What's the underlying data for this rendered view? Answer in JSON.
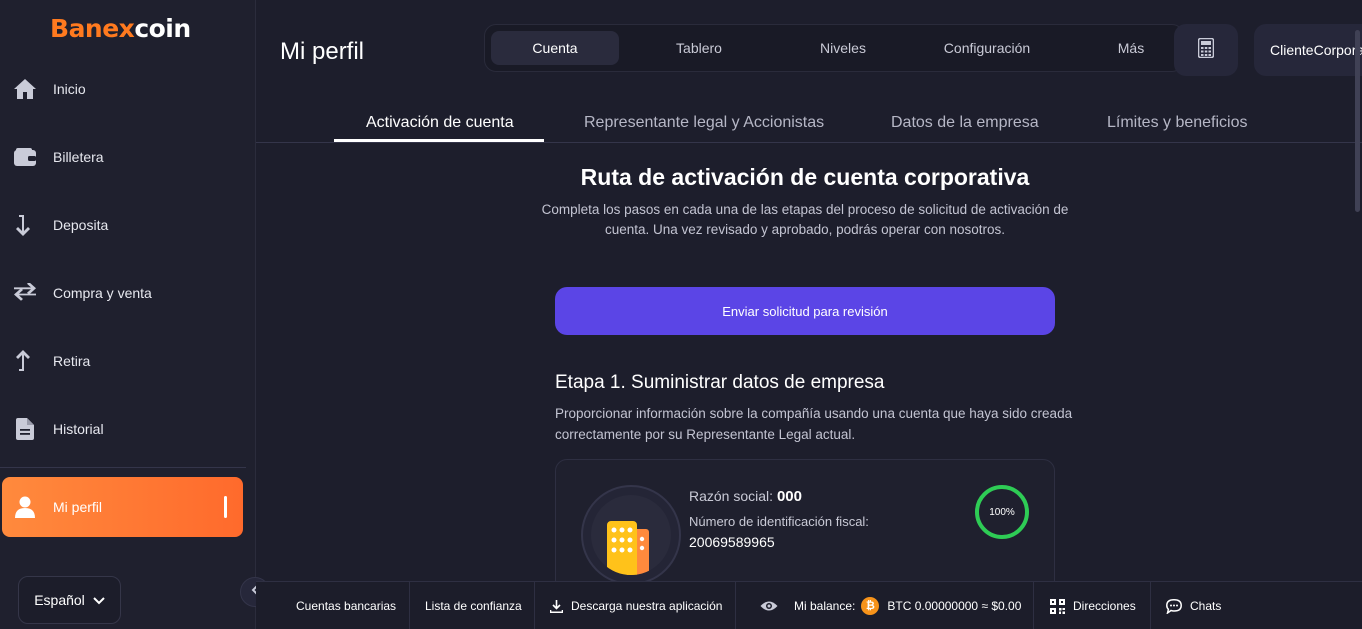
{
  "brand": {
    "logo_part1": "B",
    "logo_part2": "anex",
    "logo_part3": "coin"
  },
  "sidebar": {
    "items": [
      {
        "label": "Inicio",
        "icon": "home-icon"
      },
      {
        "label": "Billetera",
        "icon": "wallet-icon"
      },
      {
        "label": "Deposita",
        "icon": "deposit-arrow-icon"
      },
      {
        "label": "Compra y venta",
        "icon": "swap-arrows-icon"
      },
      {
        "label": "Retira",
        "icon": "withdraw-arrow-icon"
      },
      {
        "label": "Historial",
        "icon": "document-icon"
      },
      {
        "label": "Mi perfil",
        "icon": "user-icon",
        "active": true
      }
    ],
    "language": "Español"
  },
  "header": {
    "title": "Mi perfil",
    "tabs": [
      {
        "label": "Cuenta",
        "active": true
      },
      {
        "label": "Tablero"
      },
      {
        "label": "Niveles"
      },
      {
        "label": "Configuración"
      },
      {
        "label": "Más"
      }
    ],
    "user": "ClienteCorporativo"
  },
  "subtabs": [
    {
      "label": "Activación de cuenta",
      "active": true
    },
    {
      "label": "Representante legal y Accionistas"
    },
    {
      "label": "Datos de la empresa"
    },
    {
      "label": "Límites y beneficios"
    }
  ],
  "main": {
    "title": "Ruta de activación de cuenta corporativa",
    "description": "Completa los pasos en cada una de las etapas del proceso de solicitud de activación de cuenta. Una vez revisado y aprobado, podrás operar con nosotros.",
    "submit_label": "Enviar solicitud para revisión",
    "stage1": {
      "title": "Etapa 1. Suministrar datos de empresa",
      "description": "Proporcionar información sobre la compañía usando una cuenta que haya sido creada correctamente por su Representante Legal actual.",
      "company_label": "Razón social:",
      "company_value": "000",
      "tax_id_label": "Número de identificación fiscal:",
      "tax_id_value": "20069589965",
      "progress_label": "100%",
      "progress_value": 1.0
    }
  },
  "footer": {
    "bank_accounts": "Cuentas bancarias",
    "trust_list": "Lista de confianza",
    "download_app": "Descarga nuestra aplicación",
    "balance_label": "Mi balance:",
    "balance_value": "BTC 0.00000000 ≈ $0.00",
    "addresses": "Direcciones",
    "chats": "Chats"
  },
  "colors": {
    "accent_orange": "#ff7a1f",
    "primary_purple": "#5b45e6",
    "progress_green": "#2ecc55",
    "btc_orange": "#f7931a"
  }
}
